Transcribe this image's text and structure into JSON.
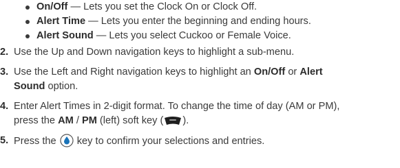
{
  "bullets": [
    {
      "term": "On/Off",
      "desc": " — Lets you set the Clock On or Clock Off."
    },
    {
      "term": "Alert Time",
      "desc": " — Lets you enter the beginning and ending hours."
    },
    {
      "term": "Alert Sound",
      "desc": " — Lets you select Cuckoo or Female Voice."
    }
  ],
  "steps": [
    {
      "num": "2.",
      "text": "Use the Up and Down navigation keys to highlight a sub-menu."
    },
    {
      "num": "3.",
      "line1_pre": "Use the Left and Right navigation keys to highlight an ",
      "line1_bold1": "On/Off",
      "line1_mid": " or ",
      "line1_bold2": "Alert",
      "line2_bold": "Sound",
      "line2_post": " option."
    },
    {
      "num": "4.",
      "line1": "Enter Alert Times in 2-digit format. To change the time of day (AM or PM),",
      "line2_pre": "press the ",
      "line2_bold1": "AM",
      "line2_mid": " / ",
      "line2_bold2": "PM",
      "line2_post1": " (left) soft key (",
      "line2_post2": ")."
    },
    {
      "num": "5.",
      "pre": "Press the ",
      "post": " key to confirm your selections and entries."
    }
  ],
  "icons": {
    "soft_key": "left-soft-key-icon",
    "ok_key": "ok-key-icon",
    "key_color": "#1f1f1f",
    "ok_color": "#1a73b8"
  }
}
